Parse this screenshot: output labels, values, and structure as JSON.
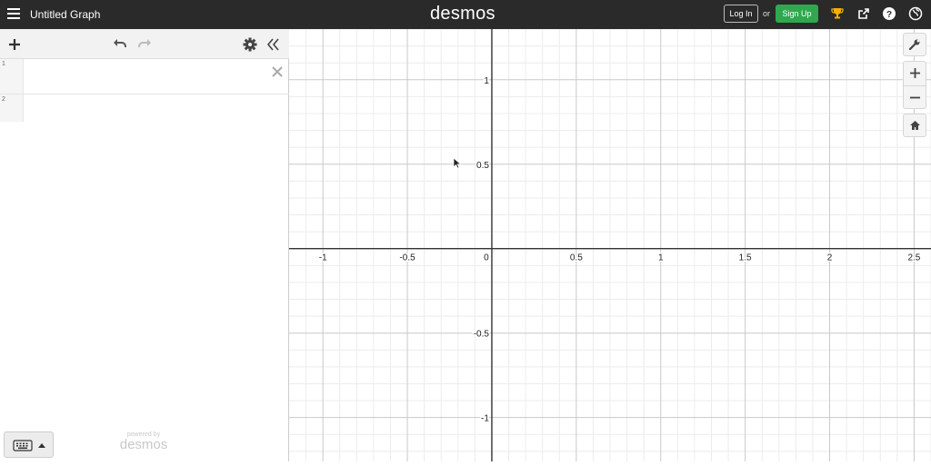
{
  "header": {
    "graph_title": "Untitled Graph",
    "logo_text": "desmos",
    "login_label": "Log In",
    "or_text": "or",
    "signup_label": "Sign Up",
    "icons": [
      "menu-icon",
      "trophy-icon",
      "share-icon",
      "help-icon",
      "globe-icon"
    ]
  },
  "sidebar": {
    "toolbar_icons": [
      "add-icon",
      "undo-icon",
      "redo-icon",
      "gear-icon",
      "collapse-icon"
    ],
    "expressions": [
      {
        "number": "1",
        "value": ""
      },
      {
        "number": "2",
        "value": ""
      }
    ],
    "powered_by": "powered by",
    "powered_logo": "desmos"
  },
  "graph": {
    "x_ticks": [
      "-1",
      "-0.5",
      "0",
      "0.5",
      "1",
      "1.5",
      "2",
      "2.5"
    ],
    "y_ticks": [
      "1",
      "0.5",
      "-0.5",
      "-1"
    ],
    "x_range": [
      -1.2,
      2.6
    ],
    "y_range": [
      -1.26,
      1.3
    ],
    "grid": true,
    "controls": [
      "wrench-icon",
      "zoom-in-icon",
      "zoom-out-icon",
      "home-icon"
    ]
  },
  "colors": {
    "topbar": "#2a2a2a",
    "signup": "#2fa84f",
    "trophy": "#f5b000"
  }
}
